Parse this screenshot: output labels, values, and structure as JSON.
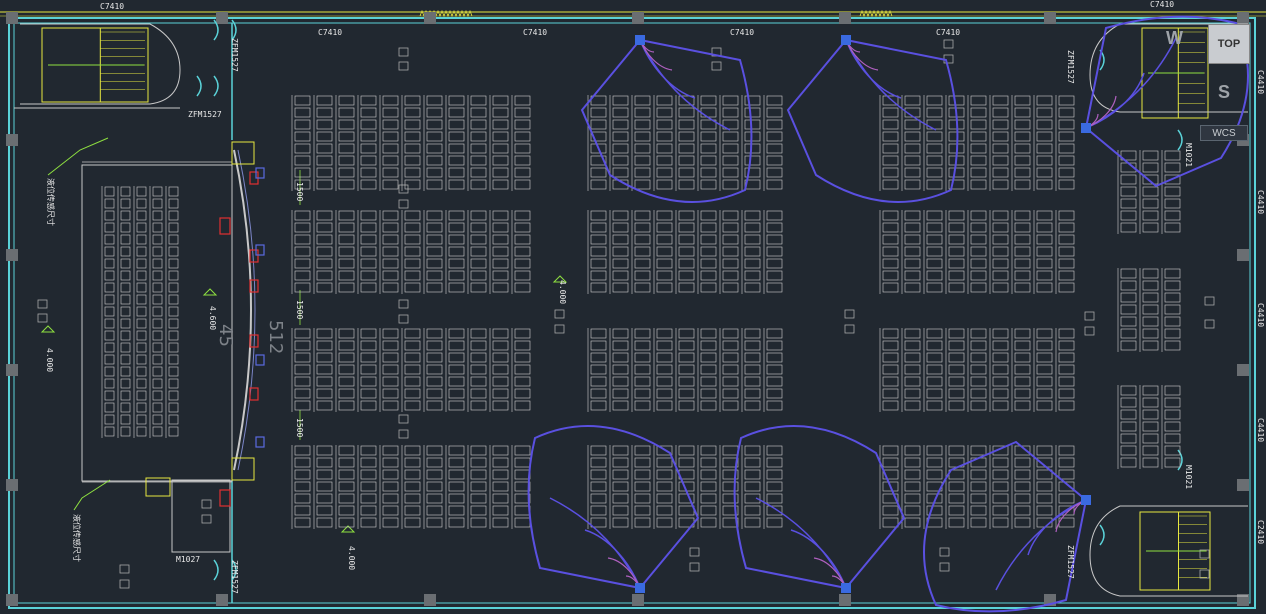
{
  "grid_labels": {
    "top": [
      "C7410",
      "C7410",
      "C7410",
      "C7410",
      "C7410",
      "C7410"
    ],
    "right": [
      "C4410",
      "C4410",
      "C4410",
      "C4410",
      "C2410"
    ]
  },
  "dimensions": [
    "1500",
    "1500",
    "1500"
  ],
  "elevations": [
    "4.000",
    "4.600",
    "4.000",
    "4.000"
  ],
  "doors": {
    "fire_door_a": "ZFM1527",
    "fire_door_b": "ZFM1527",
    "fire_door_c": "ZFM1527",
    "fire_door_d": "ZFM1527",
    "fire_door_e": "ZFM1527",
    "door_m1027": "M1027",
    "door_m1021_a": "M1021",
    "door_m1021_b": "M1021"
  },
  "notes": {
    "stage_note_top": "液位传感尺寸",
    "stage_note_bottom": "液位传感尺寸"
  },
  "hall_labels": {
    "stage_count": "45",
    "hall_count": "512"
  },
  "viewcube": {
    "top": "TOP",
    "west": "W",
    "south": "S"
  },
  "wcs_label": "WCS",
  "colors": {
    "background": "#212830",
    "wall": "#5ad2d8",
    "seat": "#d0d0d0",
    "speaker_coverage": "#5a50e0",
    "speaker_inner": "#b060c0",
    "stair": "#e8e840",
    "annotation": "#8ee040",
    "equipment_red": "#e03030"
  }
}
